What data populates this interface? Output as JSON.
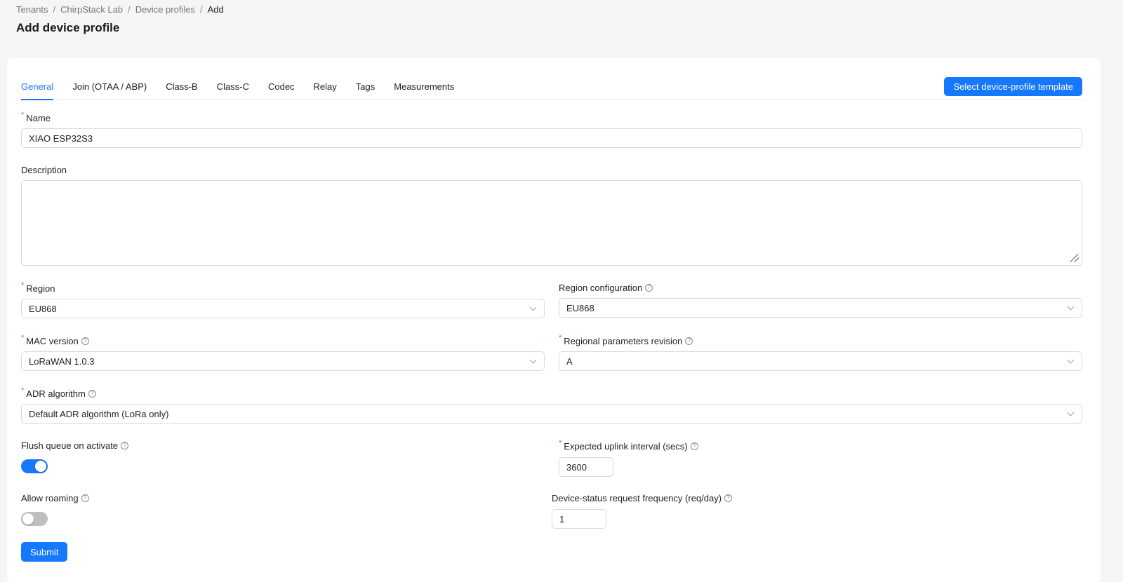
{
  "breadcrumb": [
    "Tenants",
    "ChirpStack Lab",
    "Device profiles",
    "Add"
  ],
  "page_title": "Add device profile",
  "tabs": [
    "General",
    "Join (OTAA / ABP)",
    "Class-B",
    "Class-C",
    "Codec",
    "Relay",
    "Tags",
    "Measurements"
  ],
  "template_button": "Select device-profile template",
  "help_glyph": "?",
  "fields": {
    "name": {
      "label": "Name",
      "value": "XIAO ESP32S3"
    },
    "description": {
      "label": "Description",
      "value": ""
    },
    "region": {
      "label": "Region",
      "value": "EU868"
    },
    "region_config": {
      "label": "Region configuration",
      "value": "EU868"
    },
    "mac_version": {
      "label": "MAC version",
      "value": "LoRaWAN 1.0.3"
    },
    "reg_params": {
      "label": "Regional parameters revision",
      "value": "A"
    },
    "adr": {
      "label": "ADR algorithm",
      "value": "Default ADR algorithm (LoRa only)"
    },
    "flush_queue": {
      "label": "Flush queue on activate",
      "enabled": true
    },
    "uplink_interval": {
      "label": "Expected uplink interval (secs)",
      "value": "3600"
    },
    "allow_roaming": {
      "label": "Allow roaming",
      "enabled": false
    },
    "dev_status_freq": {
      "label": "Device-status request frequency (req/day)",
      "value": "1"
    }
  },
  "submit_label": "Submit",
  "colors": {
    "accent": "#1677ff",
    "required": "#ff4d4f",
    "switch_off": "#bfbfbf"
  }
}
